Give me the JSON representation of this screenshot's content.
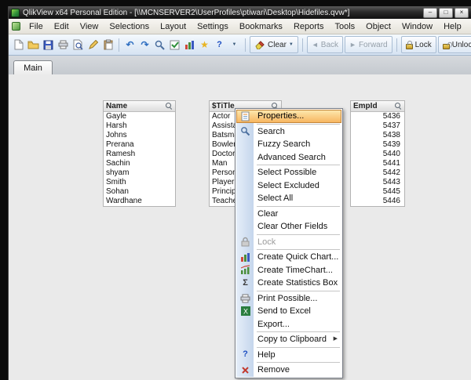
{
  "window": {
    "title": "QlikView x64 Personal Edition - [\\\\MCNSERVER2\\UserProfiles\\ptiwari\\Desktop\\Hidefiles.qvw*]"
  },
  "icons": {
    "minimize": "–",
    "restore": "□",
    "close": "×",
    "undo": "↶",
    "redo": "↷",
    "star": "★",
    "help": "?",
    "sigma": "Σ",
    "dropdown": "▼",
    "submenu": "▶",
    "back_arrow": "◄",
    "forward_arrow": "►"
  },
  "menubar": {
    "items": [
      "File",
      "Edit",
      "View",
      "Selections",
      "Layout",
      "Settings",
      "Bookmarks",
      "Reports",
      "Tools",
      "Object",
      "Window",
      "Help"
    ]
  },
  "toolbar": {
    "clear": "Clear",
    "back": "Back",
    "forward": "Forward",
    "lock": "Lock",
    "unlock": "Unlock"
  },
  "tabs": [
    {
      "label": "Main"
    }
  ],
  "listboxes": [
    {
      "title": "Name",
      "values": [
        "Gayle",
        "Harsh",
        "Johns",
        "Prerana",
        "Ramesh",
        "Sachin",
        "shyam",
        "Smith",
        "Sohan",
        "Wardhane"
      ]
    },
    {
      "title": "$TiTle",
      "values": [
        "Actor",
        "Assista",
        "Batsma",
        "Bowler",
        "Doctor",
        "Man",
        "Person",
        "Player",
        "Princip",
        "Teache"
      ]
    },
    {
      "title": "EmpId",
      "values": [
        "5436",
        "5437",
        "5438",
        "5439",
        "5440",
        "5441",
        "5442",
        "5443",
        "5445",
        "5446"
      ]
    }
  ],
  "context_menu": {
    "items": [
      {
        "label": "Properties..."
      },
      {
        "label": "Search"
      },
      {
        "label": "Fuzzy Search"
      },
      {
        "label": "Advanced Search"
      },
      {
        "label": "Select Possible"
      },
      {
        "label": "Select Excluded"
      },
      {
        "label": "Select All"
      },
      {
        "label": "Clear"
      },
      {
        "label": "Clear Other Fields"
      },
      {
        "label": "Lock"
      },
      {
        "label": "Create Quick Chart..."
      },
      {
        "label": "Create TimeChart..."
      },
      {
        "label": "Create Statistics Box"
      },
      {
        "label": "Print Possible..."
      },
      {
        "label": "Send to Excel"
      },
      {
        "label": "Export..."
      },
      {
        "label": "Copy to Clipboard"
      },
      {
        "label": "Help"
      },
      {
        "label": "Remove"
      }
    ]
  }
}
